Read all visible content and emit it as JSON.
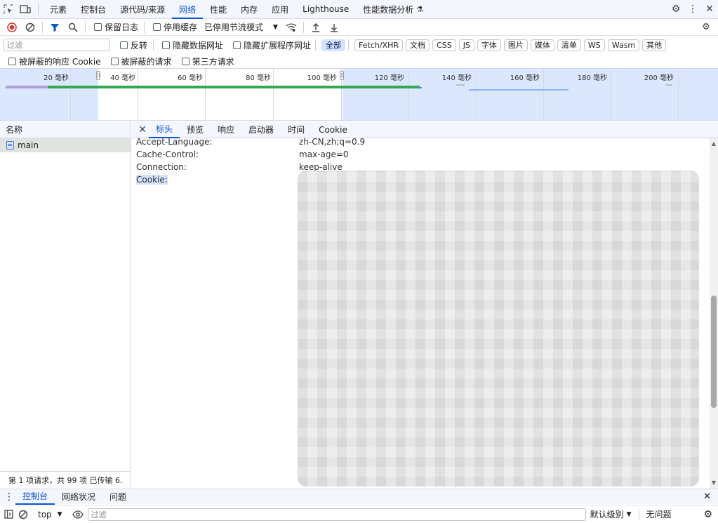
{
  "tabbar": {
    "tabs": [
      "元素",
      "控制台",
      "源代码/来源",
      "网络",
      "性能",
      "内存",
      "应用",
      "Lighthouse",
      "性能数据分析"
    ],
    "active_index": 3
  },
  "toolbar": {
    "preserve_log": "保留日志",
    "disable_cache": "停用缓存",
    "throttle": "已停用节流模式"
  },
  "filter": {
    "placeholder": "过滤",
    "invert": "反转",
    "hide_data_urls": "隐藏数据网址",
    "hide_ext_urls": "隐藏扩展程序网址",
    "chips": [
      "全部",
      "Fetch/XHR",
      "文档",
      "CSS",
      "JS",
      "字体",
      "图片",
      "媒体",
      "清单",
      "WS",
      "Wasm",
      "其他"
    ],
    "blocked_cookies": "被屏蔽的响应 Cookie",
    "blocked_requests": "被屏蔽的请求",
    "third_party": "第三方请求"
  },
  "overview": {
    "ticks": [
      "20 毫秒",
      "40 毫秒",
      "60 毫秒",
      "80 毫秒",
      "100 毫秒",
      "120 毫秒",
      "140 毫秒",
      "160 毫秒",
      "180 毫秒",
      "200 毫秒"
    ]
  },
  "names": {
    "header": "名称",
    "rows": [
      "main"
    ],
    "footer": "第 1 项请求，共 99 项  已传输 6."
  },
  "details": {
    "tabs": [
      "标头",
      "预览",
      "响应",
      "启动器",
      "时间",
      "Cookie"
    ],
    "active_index": 0,
    "headers": [
      {
        "k": "Accept-Language:",
        "v": "zh-CN,zh;q=0.9"
      },
      {
        "k": "Cache-Control:",
        "v": "max-age=0"
      },
      {
        "k": "Connection:",
        "v": "keep-alive"
      },
      {
        "k": "Cookie:",
        "v": ""
      }
    ]
  },
  "drawer": {
    "tabs": [
      "控制台",
      "网络状况",
      "问题"
    ],
    "active_index": 0,
    "context": "top",
    "filter_placeholder": "过滤",
    "level": "默认级别",
    "issues": "无问题"
  },
  "colors": {
    "accent": "#0b57d0",
    "panel_bg": "#f3f6fc",
    "selection": "#d3e3fd"
  }
}
